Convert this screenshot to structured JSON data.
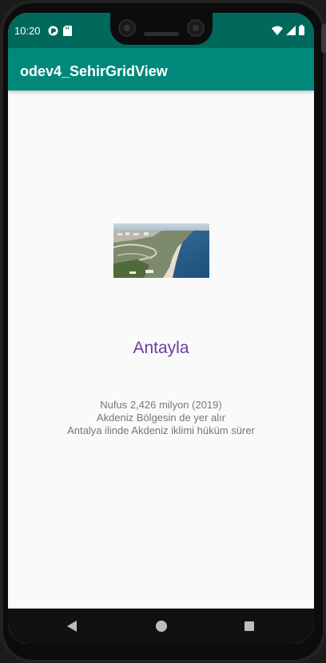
{
  "status_bar": {
    "time": "10:20",
    "left_icons": [
      "sync-icon",
      "sd-card-icon"
    ],
    "right_icons": [
      "wifi-icon",
      "signal-icon",
      "battery-icon"
    ],
    "background_color": "#00695c"
  },
  "app_bar": {
    "title": "odev4_SehirGridView",
    "background_color": "#00897b"
  },
  "detail": {
    "image_icon": "city-photo-antalya",
    "city_name": "Antayla",
    "info_lines": [
      "Nufus 2,426 milyon (2019)",
      "Akdeniz Bölgesin de yer alır",
      "Antalya ilinde Akdeniz iklimi hüküm sürer"
    ],
    "city_name_color": "#6a3fa0"
  },
  "nav_bar": {
    "buttons": [
      "back-icon",
      "home-icon",
      "recents-icon"
    ]
  }
}
